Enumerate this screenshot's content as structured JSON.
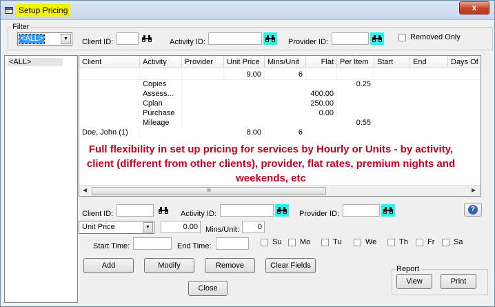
{
  "window": {
    "title": "Setup Pricing",
    "close_glyph": "x"
  },
  "filter": {
    "legend": "Filter",
    "combo_value": "<ALL>",
    "client_id_label": "Client ID:",
    "client_id_value": "",
    "activity_id_label": "Activity ID:",
    "activity_id_value": "",
    "provider_id_label": "Provider ID:",
    "provider_id_value": "",
    "removed_only_label": "Removed Only"
  },
  "tree": {
    "items": [
      "<ALL>"
    ]
  },
  "grid": {
    "columns": [
      "Client",
      "Activity",
      "Provider",
      "Unit Price",
      "Mins/Unit",
      "Flat",
      "Per Item",
      "Start",
      "End",
      "Days Of"
    ],
    "rows": [
      [
        "",
        "",
        "",
        "9.00",
        "6",
        "",
        "",
        "",
        "",
        ""
      ],
      [
        "",
        "",
        "",
        "",
        "",
        "",
        "",
        "",
        "",
        ""
      ],
      [
        "",
        "Copies",
        "",
        "",
        "",
        "",
        "0.25",
        "",
        "",
        ""
      ],
      [
        "",
        "Assess...",
        "",
        "",
        "",
        "400.00",
        "",
        "",
        "",
        ""
      ],
      [
        "",
        "Cplan",
        "",
        "",
        "",
        "250.00",
        "",
        "",
        "",
        ""
      ],
      [
        "",
        "Purchase",
        "",
        "",
        "",
        "0.00",
        "",
        "",
        "",
        ""
      ],
      [
        "",
        "Mileage",
        "",
        "",
        "",
        "",
        "0.55",
        "",
        "",
        ""
      ],
      [
        "Doe, John (1)",
        "",
        "",
        "8.00",
        "6",
        "",
        "",
        "",
        "",
        ""
      ]
    ],
    "scroll_thumb_glyph": "III"
  },
  "promo_text": "Full flexibility in set up pricing for services by Hourly or Units - by activity, client (different from other clients), provider, flat rates, premium nights and weekends, etc",
  "editor": {
    "client_id_label": "Client ID:",
    "client_id_value": "",
    "activity_id_label": "Activity ID:",
    "activity_id_value": "",
    "provider_id_label": "Provider ID:",
    "provider_id_value": "",
    "pricing_type": "Unit Price",
    "price_value": "0.00",
    "mins_unit_label": "Mins/Unit:",
    "mins_unit_value": "0",
    "start_time_label": "Start Time:",
    "start_time_value": "",
    "end_time_label": "End Time:",
    "end_time_value": "",
    "days": [
      "Su",
      "Mo",
      "Tu",
      "We",
      "Th",
      "Fr",
      "Sa"
    ]
  },
  "buttons": {
    "add": "Add",
    "modify": "Modify",
    "remove": "Remove",
    "clear_fields": "Clear Fields",
    "close": "Close"
  },
  "report": {
    "legend": "Report",
    "view": "View",
    "print": "Print"
  },
  "colors": {
    "title_highlight": "#f7f400",
    "binoculars_bg": "#29f1ee",
    "promo_text": "#c8001e",
    "close_button": "#c8412b"
  }
}
